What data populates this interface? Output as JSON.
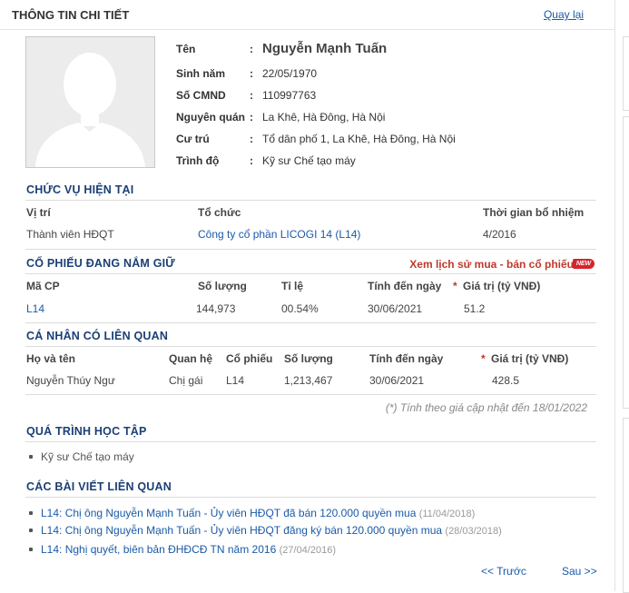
{
  "header": {
    "title": "THÔNG TIN CHI TIẾT",
    "back_label": "Quay lại"
  },
  "profile": {
    "avatar_icon": "person-silhouette-icon",
    "fields": [
      {
        "label": "Tên",
        "value": "Nguyễn Mạnh Tuấn"
      },
      {
        "label": "Sinh năm",
        "value": "22/05/1970"
      },
      {
        "label": "Số CMND",
        "value": "110997763"
      },
      {
        "label": "Nguyên quán",
        "value": "La Khê, Hà Đông, Hà Nội"
      },
      {
        "label": "Cư trú",
        "value": "Tổ dân phố 1, La Khê, Hà Đông, Hà Nội"
      },
      {
        "label": "Trình độ",
        "value": "Kỹ sư Chế tạo máy"
      }
    ],
    "colon": ":"
  },
  "position": {
    "heading": "CHỨC VỤ HIỆN TẠI",
    "columns": [
      "Vị trí",
      "Tổ chức",
      "Thời gian bổ nhiệm"
    ],
    "rows": [
      {
        "role": "Thành viên HĐQT",
        "org": "Công ty cổ phần LICOGI 14 (L14)",
        "since": "4/2016"
      }
    ]
  },
  "holdings": {
    "heading": "CỔ PHIẾU ĐANG NẮM GIỮ",
    "history_link": "Xem lịch sử mua - bán cổ phiếu",
    "new_badge": "NEW",
    "columns": [
      "Mã CP",
      "Số lượng",
      "Tỉ lệ",
      "Tính đến ngày",
      "*",
      "Giá trị (tỷ VNĐ)"
    ],
    "rows": [
      {
        "code": "L14",
        "qty": "144,973",
        "ratio": "00.54%",
        "date": "30/06/2021",
        "value": "51.2"
      }
    ]
  },
  "related": {
    "heading": "CÁ NHÂN CÓ LIÊN QUAN",
    "columns": [
      "Họ và tên",
      "Quan hệ",
      "Cổ phiếu",
      "Số lượng",
      "Tính đến ngày",
      "*",
      "Giá trị (tỷ VNĐ)"
    ],
    "rows": [
      {
        "name": "Nguyễn Thúy Ngư",
        "relation": "Chị gái",
        "stock": "L14",
        "qty": "1,213,467",
        "date": "30/06/2021",
        "value": "428.5"
      }
    ],
    "note": "(*) Tính theo giá cập nhật đến 18/01/2022"
  },
  "education": {
    "heading": "QUÁ TRÌNH HỌC TẬP",
    "items": [
      "Kỹ sư Chế tạo máy"
    ]
  },
  "articles": {
    "heading": "CÁC BÀI VIẾT LIÊN QUAN",
    "items": [
      {
        "title": "L14: Chị ông Nguyễn Mạnh Tuấn - Ủy viên HĐQT đã bán 120.000 quyền mua",
        "date": "(11/04/2018)"
      },
      {
        "title": "L14: Chị ông Nguyễn Mạnh Tuấn - Ủy viên HĐQT đăng ký bán 120.000 quyền mua",
        "date": "(28/03/2018)"
      },
      {
        "title": "L14: Nghị quyết, biên bản ĐHĐCĐ TN năm 2016",
        "date": "(27/04/2016)"
      }
    ],
    "prev_label": "<< Trước",
    "next_label": "Sau >>"
  },
  "colors": {
    "heading": "#1b3f74",
    "link": "#1a5aa8",
    "accent_red": "#c0392b"
  }
}
